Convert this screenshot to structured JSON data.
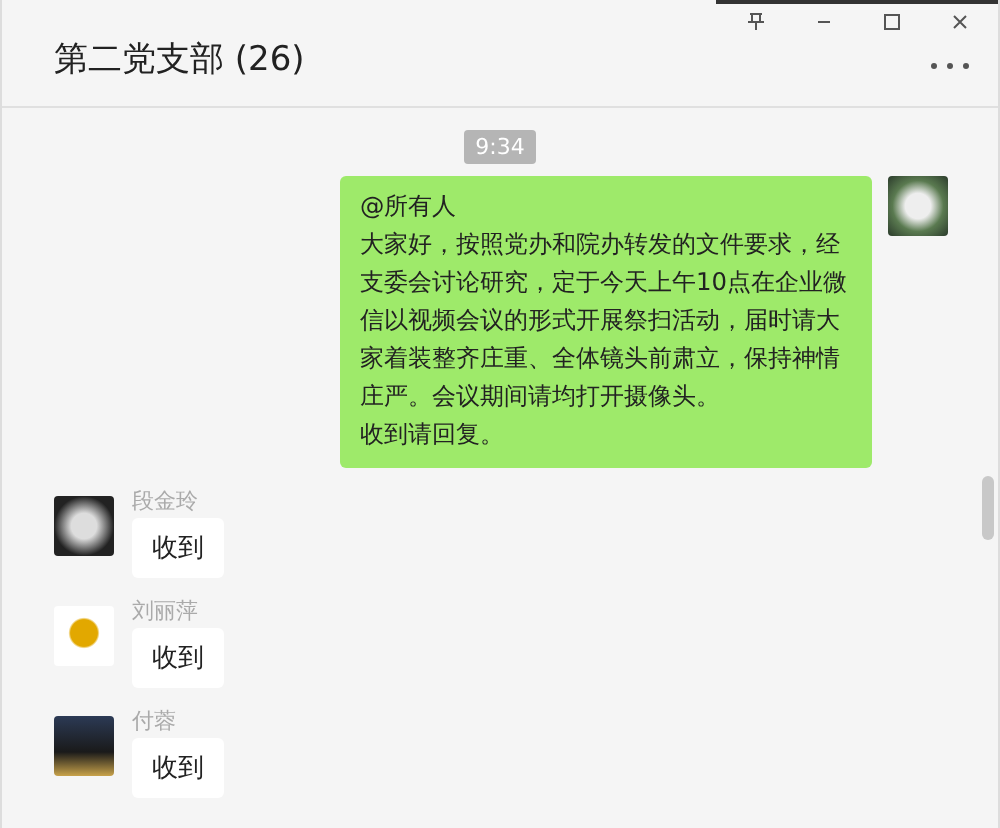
{
  "window": {
    "title": "第二党支部 (26)"
  },
  "time_divider": "9:34",
  "messages": [
    {
      "kind": "outgoing",
      "mention": "@所有人",
      "text": "大家好，按照党办和院办转发的文件要求，经支委会讨论研究，定于今天上午10点在企业微信以视频会议的形式开展祭扫活动，届时请大家着装整齐庄重、全体镜头前肃立，保持神情庄严。会议期间请均打开摄像头。"
    },
    {
      "kind": "outgoing_line",
      "text": "收到请回复。"
    },
    {
      "kind": "incoming",
      "sender": "段金玲",
      "text": "收到"
    },
    {
      "kind": "incoming",
      "sender": "刘丽萍",
      "text": "收到"
    },
    {
      "kind": "incoming",
      "sender": "付蓉",
      "text": "收到"
    }
  ]
}
